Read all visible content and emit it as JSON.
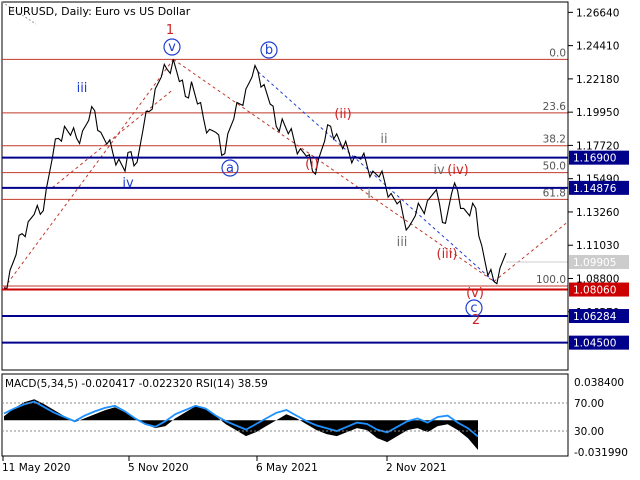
{
  "header": {
    "symbol": "EURUSD, Daily:",
    "description": "Euro vs US Dollar"
  },
  "colors": {
    "price": "#000000",
    "fib": "#c0392b",
    "level_red": "#cc0000",
    "level_blue": "#00008b",
    "wave_blue": "#1f3fd1",
    "wave_red": "#cc2222",
    "wave_gray": "#707070",
    "macd_hist": "#000000",
    "rsi_line": "#1e90ff",
    "current_price": "#cccccc"
  },
  "chart_data": [
    {
      "type": "line",
      "title": "EURUSD, Daily:  Euro vs US Dollar",
      "price_axis_ticks": [
        "1.26640",
        "1.24410",
        "1.22180",
        "1.19950",
        "1.17720",
        "1.15490",
        "1.13260",
        "1.11030",
        "1.08800",
        "1.06570"
      ],
      "date_ticks": [
        "11 May 2020",
        "5 Nov 2020",
        "6 May 2021",
        "2 Nov 2021"
      ],
      "ylim": [
        1.028,
        1.272
      ],
      "current_price": "1.09905",
      "series": [
        {
          "values": [
            1.0815,
            1.0935,
            1.104,
            1.118,
            1.126,
            1.131,
            1.131,
            1.148,
            1.169,
            1.182,
            1.19,
            1.184,
            1.182,
            1.187,
            1.194,
            1.2005,
            1.186,
            1.178,
            1.172,
            1.168,
            1.16,
            1.173,
            1.166,
            1.188,
            1.2,
            1.215,
            1.223,
            1.228,
            1.2349,
            1.22,
            1.21,
            1.22,
            1.205,
            1.195,
            1.188,
            1.186,
            1.1705,
            1.185,
            1.195,
            1.205,
            1.215,
            1.223,
            1.2266,
            1.218,
            1.205,
            1.19,
            1.195,
            1.185,
            1.18,
            1.175,
            1.17,
            1.16,
            1.168,
            1.18,
            1.19,
            1.185,
            1.175,
            1.173,
            1.17,
            1.168,
            1.164,
            1.16,
            1.156,
            1.152,
            1.145,
            1.138,
            1.13,
            1.123,
            1.13,
            1.135,
            1.14,
            1.145,
            1.138,
            1.125,
            1.145,
            1.147,
            1.135,
            1.13,
            1.135,
            1.11,
            1.09,
            1.086,
            1.095,
            1.105
          ]
        }
      ],
      "fib_levels": [
        {
          "label": "0.0",
          "value": 1.2349
        },
        {
          "label": "23.6",
          "value": 1.199
        },
        {
          "label": "38.2",
          "value": 1.177
        },
        {
          "label": "50.0",
          "value": 1.159
        },
        {
          "label": "61.8",
          "value": 1.141
        },
        {
          "label": "100.0",
          "value": 1.083
        }
      ],
      "key_levels": [
        {
          "label": "1.16900",
          "value": 1.169,
          "style": "blue"
        },
        {
          "label": "1.14876",
          "value": 1.14876,
          "style": "blue"
        },
        {
          "label": "1.08060",
          "value": 1.0806,
          "style": "red"
        },
        {
          "label": "1.06284",
          "value": 1.06284,
          "style": "blue"
        },
        {
          "label": "1.04500",
          "value": 1.045,
          "style": "blue"
        }
      ],
      "wave_labels": [
        {
          "text": "1",
          "color": "red",
          "circled": false
        },
        {
          "text": "v",
          "color": "blue",
          "circled": true
        },
        {
          "text": "iii",
          "color": "blue",
          "circled": false
        },
        {
          "text": "iv",
          "color": "blue",
          "circled": false
        },
        {
          "text": "b",
          "color": "blue",
          "circled": true
        },
        {
          "text": "a",
          "color": "blue",
          "circled": true
        },
        {
          "text": "(i)",
          "color": "red",
          "circled": false
        },
        {
          "text": "(ii)",
          "color": "red",
          "circled": false
        },
        {
          "text": "ii",
          "color": "gray",
          "circled": false
        },
        {
          "text": "i",
          "color": "gray",
          "circled": false
        },
        {
          "text": "iii",
          "color": "gray",
          "circled": false
        },
        {
          "text": "iv",
          "color": "gray",
          "circled": false
        },
        {
          "text": "(iv)",
          "color": "red",
          "circled": false
        },
        {
          "text": "(iii)",
          "color": "red",
          "circled": false
        },
        {
          "text": "(v)",
          "color": "red",
          "circled": false
        },
        {
          "text": "c",
          "color": "blue",
          "circled": true
        },
        {
          "text": "2",
          "color": "red",
          "circled": false
        }
      ]
    },
    {
      "type": "area",
      "title": "MACD(5,34,5) -0.020417 -0.022320 RSI(14) 38.59",
      "axis_ticks": [
        "0.038400",
        "70.00",
        "30.00",
        "-0.031990"
      ],
      "ylim_macd": [
        -0.032,
        0.0384
      ],
      "rsi_levels": [
        70,
        30
      ],
      "series": [
        {
          "name": "MACD",
          "values": [
            0.004,
            0.012,
            0.018,
            0.021,
            0.016,
            0.01,
            0.004,
            -0.002,
            0.002,
            0.006,
            0.01,
            0.013,
            0.008,
            0.002,
            -0.004,
            -0.008,
            -0.006,
            0.002,
            0.008,
            0.014,
            0.012,
            0.004,
            -0.004,
            -0.01,
            -0.016,
            -0.012,
            -0.006,
            0.0,
            0.006,
            0.002,
            -0.004,
            -0.01,
            -0.014,
            -0.016,
            -0.012,
            -0.008,
            -0.01,
            -0.018,
            -0.022,
            -0.016,
            -0.01,
            -0.008,
            -0.012,
            -0.006,
            -0.004,
            -0.01,
            -0.018,
            -0.03
          ]
        },
        {
          "name": "RSI",
          "values": [
            55,
            62,
            68,
            72,
            64,
            56,
            50,
            44,
            52,
            58,
            63,
            66,
            58,
            48,
            40,
            36,
            44,
            54,
            60,
            66,
            62,
            52,
            44,
            38,
            32,
            40,
            48,
            56,
            60,
            52,
            44,
            38,
            34,
            30,
            36,
            42,
            40,
            32,
            28,
            36,
            44,
            48,
            42,
            50,
            52,
            42,
            34,
            22
          ]
        }
      ]
    }
  ]
}
